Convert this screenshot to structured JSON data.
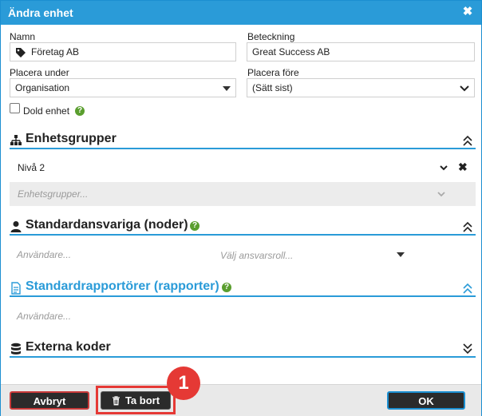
{
  "dialog": {
    "title": "Ändra enhet",
    "close_glyph": "✖"
  },
  "form": {
    "name_label": "Namn",
    "name_value": "Företag AB",
    "designation_label": "Beteckning",
    "designation_value": "Great Success AB",
    "place_under_label": "Placera under",
    "place_under_value": "Organisation",
    "place_before_label": "Placera före",
    "place_before_value": "(Sätt sist)",
    "hidden_unit_label": "Dold enhet",
    "help_glyph": "?"
  },
  "sections": {
    "unit_groups": {
      "title": "Enhetsgrupper",
      "level_item": "Nivå 2",
      "remove_glyph": "✖",
      "input_placeholder": "Enhetsgrupper..."
    },
    "default_responsible": {
      "title": "Standardansvariga (noder)",
      "users_placeholder": "Användare...",
      "role_placeholder": "Välj ansvarsroll..."
    },
    "default_reporters": {
      "title": "Standardrapportörer (rapporter)",
      "users_placeholder": "Användare..."
    },
    "external_codes": {
      "title": "Externa koder"
    }
  },
  "footer": {
    "cancel_label": "Avbryt",
    "delete_label": "Ta bort",
    "ok_label": "OK"
  },
  "annotation": {
    "badge_number": "1"
  },
  "colors": {
    "accent": "#2a9bd8",
    "help": "#5a9e2e",
    "highlight": "#e53935"
  }
}
